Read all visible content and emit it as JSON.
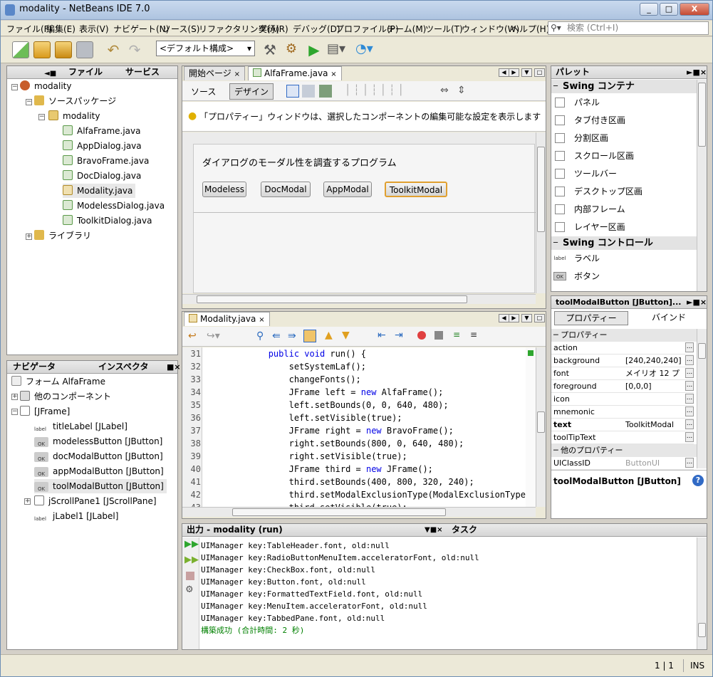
{
  "window": {
    "title": "modality - NetBeans IDE 7.0",
    "controls": {
      "minimize": "_",
      "maximize": "□",
      "close": "X"
    }
  },
  "menu": [
    "ファイル(F)",
    "編集(E)",
    "表示(V)",
    "ナビゲート(N)",
    "ソース(S)",
    "リファクタリング(A)",
    "実行(R)",
    "デバッグ(D)",
    "プロファイル(P)",
    "チーム(M)",
    "ツール(T)",
    "ウィンドウ(W)",
    "ヘルプ(H)"
  ],
  "search": {
    "placeholder": "検索 (Ctrl+I)"
  },
  "toolbar": {
    "config_combo": "<デフォルト構成>"
  },
  "projects": {
    "tabs": [
      "ファイル",
      "サービス"
    ],
    "tree": [
      {
        "label": "modality"
      },
      {
        "label": "ソースパッケージ"
      },
      {
        "label": "modality"
      },
      {
        "label": "AlfaFrame.java"
      },
      {
        "label": "AppDialog.java"
      },
      {
        "label": "BravoFrame.java"
      },
      {
        "label": "DocDialog.java"
      },
      {
        "label": "Modality.java"
      },
      {
        "label": "ModelessDialog.java"
      },
      {
        "label": "ToolkitDialog.java"
      },
      {
        "label": "ライブラリ"
      }
    ]
  },
  "navigator": {
    "tabs": [
      "ナビゲータ",
      "インスペクタ"
    ],
    "tree": [
      {
        "label": "フォーム AlfaFrame"
      },
      {
        "label": "他のコンポーネント"
      },
      {
        "label": "[JFrame]"
      },
      {
        "label": "titleLabel [JLabel]",
        "badge": "label"
      },
      {
        "label": "modelessButton [JButton]",
        "badge": "OK"
      },
      {
        "label": "docModalButton [JButton]",
        "badge": "OK"
      },
      {
        "label": "appModalButton [JButton]",
        "badge": "OK"
      },
      {
        "label": "toolModalButton [JButton]",
        "badge": "OK"
      },
      {
        "label": "jScrollPane1 [JScrollPane]"
      },
      {
        "label": "jLabel1 [JLabel]",
        "badge": "label"
      }
    ]
  },
  "editor_top": {
    "tabs": [
      "開始ページ",
      "AlfaFrame.java"
    ],
    "mode_buttons": [
      "ソース",
      "デザイン"
    ],
    "hint": "「プロパティー」ウィンドウは、選択したコンポーネントの編集可能な設定を表示します",
    "form_title": "ダイアログのモーダル性を調査するプログラム",
    "form_buttons": [
      "Modeless",
      "DocModal",
      "AppModal",
      "ToolkitModal"
    ]
  },
  "editor_bottom": {
    "tab": "Modality.java",
    "lines": [
      {
        "num": "31",
        "code": "            public void run() {"
      },
      {
        "num": "32",
        "code": "                setSystemLaf();"
      },
      {
        "num": "33",
        "code": "                changeFonts();"
      },
      {
        "num": "34",
        "code": "                JFrame left = new AlfaFrame();"
      },
      {
        "num": "35",
        "code": "                left.setBounds(0, 0, 640, 480);"
      },
      {
        "num": "36",
        "code": "                left.setVisible(true);"
      },
      {
        "num": "37",
        "code": "                JFrame right = new BravoFrame();"
      },
      {
        "num": "38",
        "code": "                right.setBounds(800, 0, 640, 480);"
      },
      {
        "num": "39",
        "code": "                right.setVisible(true);"
      },
      {
        "num": "40",
        "code": "                JFrame third = new JFrame();"
      },
      {
        "num": "41",
        "code": "                third.setBounds(400, 800, 320, 240);"
      },
      {
        "num": "42",
        "code": "                third.setModalExclusionType(ModalExclusionType"
      },
      {
        "num": "43",
        "code": "                third.setVisible(true);"
      }
    ]
  },
  "output": {
    "tabs": [
      "出力 - modality (run)",
      "タスク"
    ],
    "lines": [
      "UIManager key:TableHeader.font, old:null",
      "UIManager key:RadioButtonMenuItem.acceleratorFont, old:null",
      "UIManager key:CheckBox.font, old:null",
      "UIManager key:Button.font, old:null",
      "UIManager key:FormattedTextField.font, old:null",
      "UIManager key:MenuItem.acceleratorFont, old:null",
      "UIManager key:TabbedPane.font, old:null"
    ],
    "success": "構築成功 (合計時間: 2 秒)"
  },
  "palette": {
    "title": "パレット",
    "categories": {
      "containers": "Swing コンテナ",
      "controls": "Swing コントロール"
    },
    "container_items": [
      "パネル",
      "タブ付き区画",
      "分割区画",
      "スクロール区画",
      "ツールバー",
      "デスクトップ区画",
      "内部フレーム",
      "レイヤー区画"
    ],
    "control_items": [
      "ラベル",
      "ボタン"
    ]
  },
  "properties": {
    "title": "toolModalButton [JButton]...",
    "tabs": [
      "プロパティー",
      "バインド"
    ],
    "section_main": "プロパティー",
    "section_other": "他のプロパティー",
    "rows": [
      {
        "name": "action",
        "value": ""
      },
      {
        "name": "background",
        "value": "[240,240,240]"
      },
      {
        "name": "font",
        "value": "メイリオ 12 プ"
      },
      {
        "name": "foreground",
        "value": "[0,0,0]"
      },
      {
        "name": "icon",
        "value": ""
      },
      {
        "name": "mnemonic",
        "value": ""
      },
      {
        "name": "text",
        "value": "ToolkitModal"
      },
      {
        "name": "toolTipText",
        "value": ""
      }
    ],
    "other_rows": [
      {
        "name": "UIClassID",
        "value": "ButtonUI"
      }
    ],
    "footer": "toolModalButton [JButton]"
  },
  "status": {
    "position": "1 | 1",
    "mode": "INS"
  },
  "colors": {
    "accent": "#316ac5",
    "selection": "#e8e8e8",
    "success": "#008000",
    "keyword": "#0000e6"
  }
}
